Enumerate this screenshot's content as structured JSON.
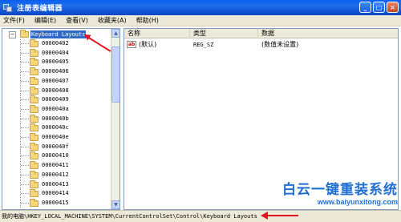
{
  "window": {
    "title": "注册表编辑器",
    "buttons": {
      "minimize": "_",
      "maximize": "□",
      "close": "×"
    }
  },
  "menu": [
    "文件(F)",
    "编辑(E)",
    "查看(V)",
    "收藏夹(A)",
    "帮助(H)"
  ],
  "tree": {
    "root": {
      "label": "Keyboard Layouts",
      "expander": "−"
    },
    "items": [
      "00000402",
      "00000404",
      "00000405",
      "00000406",
      "00000407",
      "00000408",
      "00000409",
      "0000040a",
      "0000040b",
      "0000040c",
      "0000040e",
      "0000040f",
      "00000410",
      "00000411",
      "00000412",
      "00000413",
      "00000414",
      "00000415"
    ]
  },
  "list": {
    "columns": [
      "名称",
      "类型",
      "数据"
    ],
    "rows": [
      {
        "icon": "ab",
        "name": "(默认)",
        "type": "REG_SZ",
        "data": "(数值未设置)"
      }
    ]
  },
  "statusbar": {
    "path": "我的电脑\\HKEY_LOCAL_MACHINE\\SYSTEM\\CurrentControlSet\\Control\\Keyboard Layouts"
  },
  "watermark": {
    "title": "白云一键重装系统",
    "url": "www.baiyunxitong.com"
  },
  "colors": {
    "titlebar": "#1257d8",
    "selection": "#316ac5",
    "annotation": "#e0141e",
    "watermark": "#1f6fd0"
  }
}
